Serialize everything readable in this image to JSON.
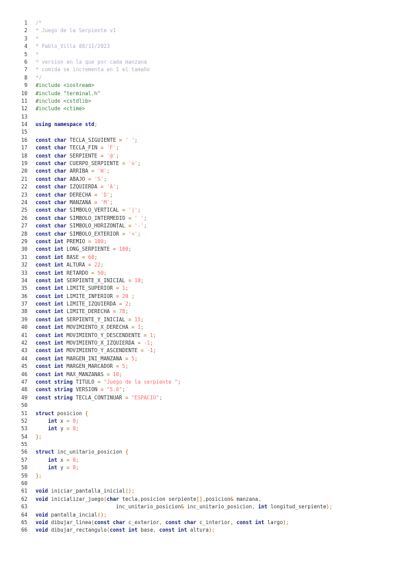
{
  "colors": {
    "comment": "#b0a8c8",
    "preprocessor": "#2e7d32",
    "keyword": "#1a237e",
    "identifier": "#333333",
    "operator": "#a05a00",
    "number": "#ff5a5a",
    "string": "#ff6a6a"
  },
  "lines": [
    {
      "n": "1",
      "tokens": [
        [
          "cm",
          "/*"
        ]
      ]
    },
    {
      "n": "2",
      "tokens": [
        [
          "cm",
          "* Juego de la Serpiente v1"
        ]
      ]
    },
    {
      "n": "3",
      "tokens": [
        [
          "cm",
          "*"
        ]
      ]
    },
    {
      "n": "4",
      "tokens": [
        [
          "cm",
          "* Pablo_Villa 08/11/2023"
        ]
      ]
    },
    {
      "n": "5",
      "tokens": [
        [
          "cm",
          "*"
        ]
      ]
    },
    {
      "n": "6",
      "tokens": [
        [
          "cm",
          "* version en la que por cada manzana"
        ]
      ]
    },
    {
      "n": "7",
      "tokens": [
        [
          "cm",
          "* comida se incrementa en 1 el tamaño"
        ]
      ]
    },
    {
      "n": "8",
      "tokens": [
        [
          "cm",
          "*/"
        ]
      ]
    },
    {
      "n": "9",
      "tokens": [
        [
          "pp",
          "#include <iostream>"
        ]
      ]
    },
    {
      "n": "10",
      "tokens": [
        [
          "pp",
          "#include \"terminal.h\""
        ]
      ]
    },
    {
      "n": "11",
      "tokens": [
        [
          "pp",
          "#include <cstdlib>"
        ]
      ]
    },
    {
      "n": "12",
      "tokens": [
        [
          "pp",
          "#include <ctime>"
        ]
      ]
    },
    {
      "n": "13",
      "tokens": []
    },
    {
      "n": "14",
      "tokens": [
        [
          "kw",
          "using namespace std"
        ],
        [
          "op",
          ";"
        ]
      ]
    },
    {
      "n": "15",
      "tokens": []
    },
    {
      "n": "16",
      "tokens": [
        [
          "kw",
          "const char "
        ],
        [
          "id",
          "TECLA_SIGUIENTE "
        ],
        [
          "op",
          "= "
        ],
        [
          "st",
          "' '"
        ],
        [
          "op",
          ";"
        ]
      ]
    },
    {
      "n": "17",
      "tokens": [
        [
          "kw",
          "const char "
        ],
        [
          "id",
          "TECLA_FIN "
        ],
        [
          "op",
          "= "
        ],
        [
          "st",
          "'F'"
        ],
        [
          "op",
          ";"
        ]
      ]
    },
    {
      "n": "18",
      "tokens": [
        [
          "kw",
          "const char "
        ],
        [
          "id",
          "SERPIENTE "
        ],
        [
          "op",
          "= "
        ],
        [
          "st",
          "'@'"
        ],
        [
          "op",
          ";"
        ]
      ]
    },
    {
      "n": "19",
      "tokens": [
        [
          "kw",
          "const char "
        ],
        [
          "id",
          "CUERPO_SERPIENTE "
        ],
        [
          "op",
          "= "
        ],
        [
          "st",
          "'o'"
        ],
        [
          "op",
          ";"
        ]
      ]
    },
    {
      "n": "20",
      "tokens": [
        [
          "kw",
          "const char "
        ],
        [
          "id",
          "ARRIBA "
        ],
        [
          "op",
          "= "
        ],
        [
          "st",
          "'W'"
        ],
        [
          "op",
          ";"
        ]
      ]
    },
    {
      "n": "21",
      "tokens": [
        [
          "kw",
          "const char "
        ],
        [
          "id",
          "ABAJO "
        ],
        [
          "op",
          "= "
        ],
        [
          "st",
          "'S'"
        ],
        [
          "op",
          ";"
        ]
      ]
    },
    {
      "n": "22",
      "tokens": [
        [
          "kw",
          "const char "
        ],
        [
          "id",
          "IZQUIERDA "
        ],
        [
          "op",
          "= "
        ],
        [
          "st",
          "'A'"
        ],
        [
          "op",
          ";"
        ]
      ]
    },
    {
      "n": "23",
      "tokens": [
        [
          "kw",
          "const char "
        ],
        [
          "id",
          "DERECHA "
        ],
        [
          "op",
          "= "
        ],
        [
          "st",
          "'D'"
        ],
        [
          "op",
          ";"
        ]
      ]
    },
    {
      "n": "24",
      "tokens": [
        [
          "kw",
          "const char "
        ],
        [
          "id",
          "MANZANA "
        ],
        [
          "op",
          "= "
        ],
        [
          "st",
          "'M'"
        ],
        [
          "op",
          ";"
        ]
      ]
    },
    {
      "n": "25",
      "tokens": [
        [
          "kw",
          "const char "
        ],
        [
          "id",
          "SIMBOLO_VERTICAL "
        ],
        [
          "op",
          "= "
        ],
        [
          "st",
          "'|'"
        ],
        [
          "op",
          ";"
        ]
      ]
    },
    {
      "n": "26",
      "tokens": [
        [
          "kw",
          "const char "
        ],
        [
          "id",
          "SIMBOLO_INTERMEDIO "
        ],
        [
          "op",
          "= "
        ],
        [
          "st",
          "' '"
        ],
        [
          "op",
          ";"
        ]
      ]
    },
    {
      "n": "27",
      "tokens": [
        [
          "kw",
          "const char "
        ],
        [
          "id",
          "SIMBOLO_HORIZONTAL "
        ],
        [
          "op",
          "= "
        ],
        [
          "st",
          "'-'"
        ],
        [
          "op",
          ";"
        ]
      ]
    },
    {
      "n": "28",
      "tokens": [
        [
          "kw",
          "const char "
        ],
        [
          "id",
          "SIMBOLO_EXTERIOR "
        ],
        [
          "op",
          "= "
        ],
        [
          "st",
          "'+'"
        ],
        [
          "op",
          ";"
        ]
      ]
    },
    {
      "n": "29",
      "tokens": [
        [
          "kw",
          "const int "
        ],
        [
          "id",
          "PREMIO "
        ],
        [
          "op",
          "= "
        ],
        [
          "nm",
          "100"
        ],
        [
          "op",
          ";"
        ]
      ]
    },
    {
      "n": "30",
      "tokens": [
        [
          "kw",
          "const int "
        ],
        [
          "id",
          "LONG_SERPIENTE "
        ],
        [
          "op",
          "= "
        ],
        [
          "nm",
          "100"
        ],
        [
          "op",
          ";"
        ]
      ]
    },
    {
      "n": "31",
      "tokens": [
        [
          "kw",
          "const int "
        ],
        [
          "id",
          "BASE "
        ],
        [
          "op",
          "= "
        ],
        [
          "nm",
          "60"
        ],
        [
          "op",
          ";"
        ]
      ]
    },
    {
      "n": "32",
      "tokens": [
        [
          "kw",
          "const int "
        ],
        [
          "id",
          "ALTURA "
        ],
        [
          "op",
          "= "
        ],
        [
          "nm",
          "22"
        ],
        [
          "op",
          ";"
        ]
      ]
    },
    {
      "n": "33",
      "tokens": [
        [
          "kw",
          "const int "
        ],
        [
          "id",
          "RETARDO "
        ],
        [
          "op",
          "= "
        ],
        [
          "nm",
          "50"
        ],
        [
          "op",
          ";"
        ]
      ]
    },
    {
      "n": "34",
      "tokens": [
        [
          "kw",
          "const int "
        ],
        [
          "id",
          "SERPIENTE_X_INICIAL "
        ],
        [
          "op",
          "= "
        ],
        [
          "nm",
          "10"
        ],
        [
          "op",
          ";"
        ]
      ]
    },
    {
      "n": "35",
      "tokens": [
        [
          "kw",
          "const int "
        ],
        [
          "id",
          "LIMITE_SUPERIOR "
        ],
        [
          "op",
          "= "
        ],
        [
          "nm",
          "1"
        ],
        [
          "op",
          ";"
        ]
      ]
    },
    {
      "n": "36",
      "tokens": [
        [
          "kw",
          "const int "
        ],
        [
          "id",
          "LIMITE_INFERIOR "
        ],
        [
          "op",
          "= "
        ],
        [
          "nm",
          "20 "
        ],
        [
          "op",
          ";"
        ]
      ]
    },
    {
      "n": "37",
      "tokens": [
        [
          "kw",
          "const int "
        ],
        [
          "id",
          "LIMITE_IZQUIERDA "
        ],
        [
          "op",
          "= "
        ],
        [
          "nm",
          "2"
        ],
        [
          "op",
          ";"
        ]
      ]
    },
    {
      "n": "38",
      "tokens": [
        [
          "kw",
          "const int "
        ],
        [
          "id",
          "LIMITE_DERECHA "
        ],
        [
          "op",
          "= "
        ],
        [
          "nm",
          "78"
        ],
        [
          "op",
          ";"
        ]
      ]
    },
    {
      "n": "39",
      "tokens": [
        [
          "kw",
          "const int "
        ],
        [
          "id",
          "SERPIENTE_Y_INICIAL "
        ],
        [
          "op",
          "= "
        ],
        [
          "nm",
          "15"
        ],
        [
          "op",
          ";"
        ]
      ]
    },
    {
      "n": "40",
      "tokens": [
        [
          "kw",
          "const int "
        ],
        [
          "id",
          "MOVIMIENTO_X_DERECHA "
        ],
        [
          "op",
          "= "
        ],
        [
          "nm",
          "1"
        ],
        [
          "op",
          ";"
        ]
      ]
    },
    {
      "n": "41",
      "tokens": [
        [
          "kw",
          "const int "
        ],
        [
          "id",
          "MOVIMIENTO_Y_DESCENDENTE "
        ],
        [
          "op",
          "= "
        ],
        [
          "nm",
          "1"
        ],
        [
          "op",
          ";"
        ]
      ]
    },
    {
      "n": "42",
      "tokens": [
        [
          "kw",
          "const int "
        ],
        [
          "id",
          "MOVIMIENTO_X_IZQUIERDA "
        ],
        [
          "op",
          "= "
        ],
        [
          "nm",
          "-1"
        ],
        [
          "op",
          ";"
        ]
      ]
    },
    {
      "n": "43",
      "tokens": [
        [
          "kw",
          "const int "
        ],
        [
          "id",
          "MOVIMIENTO_Y_ASCENDENTE "
        ],
        [
          "op",
          "= "
        ],
        [
          "nm",
          "-1"
        ],
        [
          "op",
          ";"
        ]
      ]
    },
    {
      "n": "44",
      "tokens": [
        [
          "kw",
          "const int "
        ],
        [
          "id",
          "MARGEN_INI_MANZANA "
        ],
        [
          "op",
          "= "
        ],
        [
          "nm",
          "5"
        ],
        [
          "op",
          ";"
        ]
      ]
    },
    {
      "n": "45",
      "tokens": [
        [
          "kw",
          "const int "
        ],
        [
          "id",
          "MARGEN_MARCADOR "
        ],
        [
          "op",
          "= "
        ],
        [
          "nm",
          "5"
        ],
        [
          "op",
          ";"
        ]
      ]
    },
    {
      "n": "46",
      "tokens": [
        [
          "kw",
          "const int "
        ],
        [
          "id",
          "MAX_MANZANAS "
        ],
        [
          "op",
          "= "
        ],
        [
          "nm",
          "10"
        ],
        [
          "op",
          ";"
        ]
      ]
    },
    {
      "n": "47",
      "tokens": [
        [
          "kw",
          "const string "
        ],
        [
          "id",
          "TITULO "
        ],
        [
          "op",
          "= "
        ],
        [
          "st",
          "\"Juego de la serpiente \""
        ],
        [
          "op",
          ";"
        ]
      ]
    },
    {
      "n": "48",
      "tokens": [
        [
          "kw",
          "const string "
        ],
        [
          "id",
          "VERSION "
        ],
        [
          "op",
          "= "
        ],
        [
          "st",
          "\"5.0\""
        ],
        [
          "op",
          ";"
        ]
      ]
    },
    {
      "n": "49",
      "tokens": [
        [
          "kw",
          "const string "
        ],
        [
          "id",
          "TECLA_CONTINUAR "
        ],
        [
          "op",
          "= "
        ],
        [
          "st",
          "\"ESPACIO\""
        ],
        [
          "op",
          ";"
        ]
      ]
    },
    {
      "n": "50",
      "tokens": []
    },
    {
      "n": "51",
      "tokens": [
        [
          "kw",
          "struct "
        ],
        [
          "id",
          "posicion "
        ],
        [
          "op",
          "{"
        ]
      ]
    },
    {
      "n": "52",
      "tokens": [
        [
          "id",
          "    "
        ],
        [
          "kw",
          "int "
        ],
        [
          "id",
          "x "
        ],
        [
          "op",
          "= "
        ],
        [
          "nm",
          "0"
        ],
        [
          "op",
          ";"
        ]
      ]
    },
    {
      "n": "53",
      "tokens": [
        [
          "id",
          "    "
        ],
        [
          "kw",
          "int "
        ],
        [
          "id",
          "y "
        ],
        [
          "op",
          "= "
        ],
        [
          "nm",
          "0"
        ],
        [
          "op",
          ";"
        ]
      ]
    },
    {
      "n": "54",
      "tokens": [
        [
          "op",
          "};"
        ]
      ]
    },
    {
      "n": "55",
      "tokens": []
    },
    {
      "n": "56",
      "tokens": [
        [
          "kw",
          "struct "
        ],
        [
          "id",
          "inc_unitario_posicion "
        ],
        [
          "op",
          "{"
        ]
      ]
    },
    {
      "n": "57",
      "tokens": [
        [
          "id",
          "    "
        ],
        [
          "kw",
          "int "
        ],
        [
          "id",
          "x "
        ],
        [
          "op",
          "= "
        ],
        [
          "nm",
          "0"
        ],
        [
          "op",
          ";"
        ]
      ]
    },
    {
      "n": "58",
      "tokens": [
        [
          "id",
          "    "
        ],
        [
          "kw",
          "int "
        ],
        [
          "id",
          "y "
        ],
        [
          "op",
          "= "
        ],
        [
          "nm",
          "0"
        ],
        [
          "op",
          ";"
        ]
      ]
    },
    {
      "n": "59",
      "tokens": [
        [
          "op",
          "};"
        ]
      ]
    },
    {
      "n": "60",
      "tokens": []
    },
    {
      "n": "61",
      "tokens": [
        [
          "kw",
          "void "
        ],
        [
          "id",
          "iniciar_pantalla_inicial"
        ],
        [
          "op",
          "();"
        ]
      ]
    },
    {
      "n": "62",
      "tokens": [
        [
          "kw",
          "void "
        ],
        [
          "id",
          "inicializar_juego"
        ],
        [
          "op",
          "("
        ],
        [
          "kw",
          "char "
        ],
        [
          "id",
          "tecla"
        ],
        [
          "op",
          ","
        ],
        [
          "id",
          "posicion serpiente"
        ],
        [
          "op",
          "[],"
        ],
        [
          "id",
          "posicion"
        ],
        [
          "op",
          "& "
        ],
        [
          "id",
          "manzana"
        ],
        [
          "op",
          ","
        ]
      ]
    },
    {
      "n": "63",
      "tokens": [
        [
          "id",
          "                          inc_unitario_posicion"
        ],
        [
          "op",
          "& "
        ],
        [
          "id",
          "inc_unitario_posicion"
        ],
        [
          "op",
          ", "
        ],
        [
          "kw",
          "int "
        ],
        [
          "id",
          "longitud_serpiente"
        ],
        [
          "op",
          ");"
        ]
      ]
    },
    {
      "n": "64",
      "tokens": [
        [
          "kw",
          "void "
        ],
        [
          "id",
          "pantalla_incial"
        ],
        [
          "op",
          "();"
        ]
      ]
    },
    {
      "n": "65",
      "tokens": [
        [
          "kw",
          "void "
        ],
        [
          "id",
          "dibujar_linea"
        ],
        [
          "op",
          "("
        ],
        [
          "kw",
          "const char "
        ],
        [
          "id",
          "c_exterior"
        ],
        [
          "op",
          ", "
        ],
        [
          "kw",
          "const char "
        ],
        [
          "id",
          "c_interior"
        ],
        [
          "op",
          ", "
        ],
        [
          "kw",
          "const int "
        ],
        [
          "id",
          "largo"
        ],
        [
          "op",
          ");"
        ]
      ]
    },
    {
      "n": "66",
      "tokens": [
        [
          "kw",
          "void "
        ],
        [
          "id",
          "dibujar_rectangulo"
        ],
        [
          "op",
          "("
        ],
        [
          "kw",
          "const int "
        ],
        [
          "id",
          "base"
        ],
        [
          "op",
          ", "
        ],
        [
          "kw",
          "const int "
        ],
        [
          "id",
          "altura"
        ],
        [
          "op",
          ");"
        ]
      ]
    }
  ]
}
